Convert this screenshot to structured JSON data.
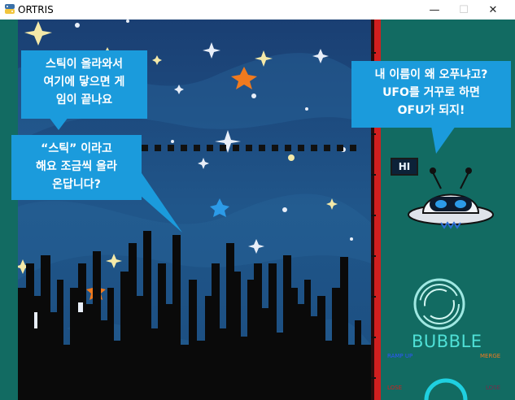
{
  "window": {
    "title": "ORTRIS",
    "controls": {
      "minimize": "—",
      "maximize": "☐",
      "close": "✕"
    }
  },
  "game": {
    "speech": {
      "limit_warning": [
        "스틱이 올라와서",
        "여기에 닿으면 게",
        "임이 끝나요"
      ],
      "stick_intro": [
        "“스틱” 이라고",
        "해요 조금씩 올라",
        "온답니다?"
      ],
      "ufo_name": [
        "내 이름이 왜 오푸냐고?",
        "UFO를 거꾸로 하면",
        "OFU가 되지!"
      ]
    },
    "ufo_sign": "HI",
    "skill_name": "BUBBLE",
    "stat_labels": {
      "ramp_up": "RAMP UP",
      "merge": "MERGE",
      "bottom_left": "LOSE",
      "bottom_right": "LOSE"
    },
    "colors": {
      "panel": "#126b62",
      "sky": "#1c4c80",
      "bubble": "#1b9bdc",
      "limit_bar": "#d11f1f",
      "skill_text": "#4fe0d6"
    }
  }
}
